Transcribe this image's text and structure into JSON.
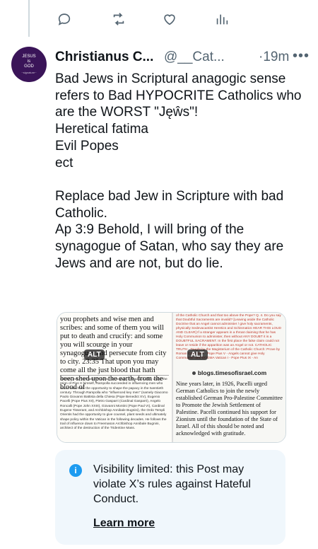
{
  "top_actions": [
    {
      "icon": "reply-icon"
    },
    {
      "icon": "repost-icon"
    },
    {
      "icon": "like-icon"
    },
    {
      "icon": "analytics-icon"
    }
  ],
  "avatar": {
    "line1": "JESUS",
    "line2": "is",
    "line3": "GOD",
    "signature": "~signature~"
  },
  "post": {
    "display_name": "Christianus C...",
    "handle": "@__Cat...",
    "time": "·19m",
    "more": "•••",
    "paragraphs": [
      "Bad Jews in Scriptural anagogic sense refers to Bad HYPOCRITE Catholics who are the WORST \"Jęŵs\"!",
      "Heretical fatima",
      "Evil Popes",
      "ect",
      "",
      "Replace bad Jew in Scripture with bad Catholic.",
      "Ap 3:9 Behold, I will bring of the synagogue of Satan, who say they are Jews and are not, but do lie."
    ]
  },
  "media": {
    "left_scripture": "you prophets and wise men and scribes: and some of them you will put to death and crucify: and some you will scourge in your synagogues and persecute from city to city. 23:35 That upon you may come all the just blood that hath been shed upon the earth, from the blood of",
    "left_article": "enlisted into Freemasonry during his sojourn in Madrid. Later, under the reign of Pius X himself, Rampolla succeeded in influencing men who would later have the opportunity to shape the papacy in the twentieth century. Through Rampolla who \"influenced key men\" (namely Giacomo Paolo Giovanni Battista della Chiesa (Pope Benedict XV), Eugenio Pacelli (Pope Pius XII), Pietro Gasparri (Cardinal Gasparri), Angelo Roncalli (Pope John XXIII), Giovanni Montini (Pope Paul VI), Cardinal Eugene Tisserant, and Archbishop Annibale Bugnini), the Ordo Templi Orientis had the opportunity to give counsel, plant seeds and ultimately shape policy within the Vatican in the following decades. He follows the trail of influence down to Freemason Archbishop Annibale Bugnini, architect of the destruction of the Tridentine Mass.",
    "right_top": "of the Catholic Church and that too above the Pope? Q. 4. Do you say that Doubtful Sacraments are invalid? [Leaving aside the Catholic Doctrine that an Angel cannot administer / give holy sacraments, physically Sedevacantist Heretics and Schismatics HEAR THIS LOUD AND CLEAR] If a stranger appears in a throat claiming that he has Holy Communion to administer, then without ANY DOUBT it is a DOUBTFUL SACRAMENT. In the first place the false claim could not leave or reside if the apparition was an Angel or not. CATHOLIC TRUTH - Taught by the Magisterium of the Catholic Church: Prove by Roman Catechism - Pope Pius V - Angels cannot give Holy Communion and DOGMA Vatican I - Pope Pius IX - An",
    "blog_label": "blogs.timesofisrael.com",
    "right_article": "Nine years later, in 1926, Pacelli urged German Catholics to join the newly established German Pro-Palestine Committee to Promote the Jewish Settlement of Palestine. Pacelli continued his support for Zionism until the foundation of the State of Israel. All of this should be noted and acknowledged with gratitude.",
    "alt_badge": "ALT"
  },
  "notice": {
    "icon": "info-icon",
    "text": "Visibility limited: this Post may violate X’s rules against Hateful Conduct.",
    "link": "Learn more"
  },
  "colors": {
    "accent": "#1d9bf0",
    "muted": "#536471",
    "notice_bg": "#f0f7fc",
    "avatar_bg": "#3a1458"
  }
}
